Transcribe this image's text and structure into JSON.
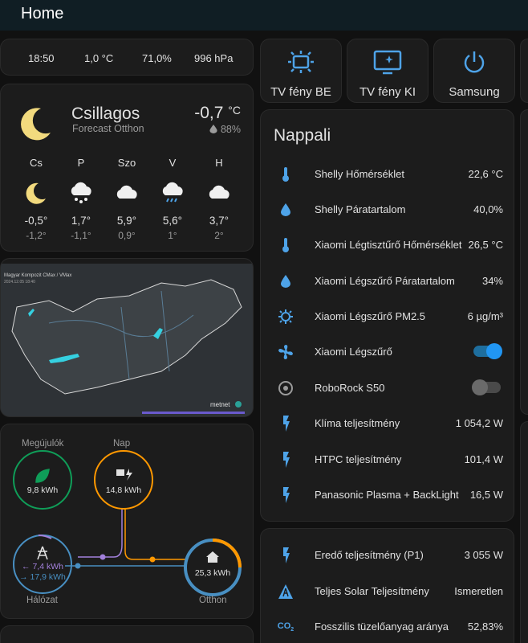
{
  "header": {
    "title": "Home"
  },
  "sensors": {
    "time": "18:50",
    "temperature": "1,0 °C",
    "humidity": "71,0%",
    "pressure": "996 hPa"
  },
  "weather": {
    "condition": "Csillagos",
    "source": "Forecast Otthon",
    "temp_value": "-0,7",
    "temp_unit": "°C",
    "humidity": "88%",
    "forecast": [
      {
        "day": "Cs",
        "high": "-0,5°",
        "low": "-1,2°",
        "icon": "moon-icon"
      },
      {
        "day": "P",
        "high": "1,7°",
        "low": "-1,1°",
        "icon": "snow-cloud-icon"
      },
      {
        "day": "Szo",
        "high": "5,9°",
        "low": "0,9°",
        "icon": "cloud-icon"
      },
      {
        "day": "V",
        "high": "5,6°",
        "low": "1°",
        "icon": "rain-cloud-icon"
      },
      {
        "day": "H",
        "high": "3,7°",
        "low": "2°",
        "icon": "cloud-icon"
      }
    ]
  },
  "map": {
    "caption": "Magyar Kompozit CMax / VMax",
    "timestamp": "2024.12.05 18:40",
    "brand": "metnet"
  },
  "energy": {
    "renewable_label": "Megújulók",
    "renewable_value": "9,8 kWh",
    "solar_label": "Nap",
    "solar_value": "14,8 kWh",
    "grid_label": "Hálózat",
    "grid_out": "← 7,4 kWh",
    "grid_in": "→ 17,9 kWh",
    "home_label": "Otthon",
    "home_value": "25,3 kWh",
    "colors": {
      "renewable": "#0f9d58",
      "solar": "#ff9800",
      "grid": "#488fc2",
      "grid_return": "#a280db"
    }
  },
  "buttons": [
    {
      "label": "TV fény BE",
      "icon": "projector-light-icon"
    },
    {
      "label": "TV fény KI",
      "icon": "tv-sparkle-icon"
    },
    {
      "label": "Samsung",
      "icon": "power-icon"
    }
  ],
  "nappali": {
    "title": "Nappali",
    "rows": [
      {
        "name": "Shelly Hőmérséklet",
        "value": "22,6 °C",
        "icon": "thermometer-icon"
      },
      {
        "name": "Shelly Páratartalom",
        "value": "40,0%",
        "icon": "water-percent-icon"
      },
      {
        "name": "Xiaomi Légtisztűrő Hőmérséklet",
        "value": "26,5 °C",
        "icon": "thermometer-icon"
      },
      {
        "name": "Xiaomi Légszűrő Páratartalom",
        "value": "34%",
        "icon": "water-percent-icon"
      },
      {
        "name": "Xiaomi Légszűrő PM2.5",
        "value": "6 µg/m³",
        "icon": "virus-icon"
      },
      {
        "name": "Xiaomi Légszűrő",
        "toggle": "on",
        "icon": "fan-icon"
      },
      {
        "name": "RoboRock S50",
        "toggle": "off",
        "icon": "robot-vacuum-icon"
      },
      {
        "name": "Klíma teljesítmény",
        "value": "1 054,2 W",
        "icon": "flash-icon"
      },
      {
        "name": "HTPC teljesítmény",
        "value": "101,4 W",
        "icon": "flash-icon"
      },
      {
        "name": "Panasonic Plasma + BackLight",
        "value": "16,5 W",
        "icon": "flash-icon"
      }
    ]
  },
  "power": {
    "rows": [
      {
        "name": "Eredő teljesítmény (P1)",
        "value": "3 055 W",
        "icon": "flash-icon"
      },
      {
        "name": "Teljes Solar Teljesítmény",
        "value": "Ismeretlen",
        "icon": "transmission-tower-icon"
      },
      {
        "name": "Fosszilis tüzelőanyag aránya",
        "value": "52,83%",
        "icon": "co2-icon"
      }
    ]
  }
}
